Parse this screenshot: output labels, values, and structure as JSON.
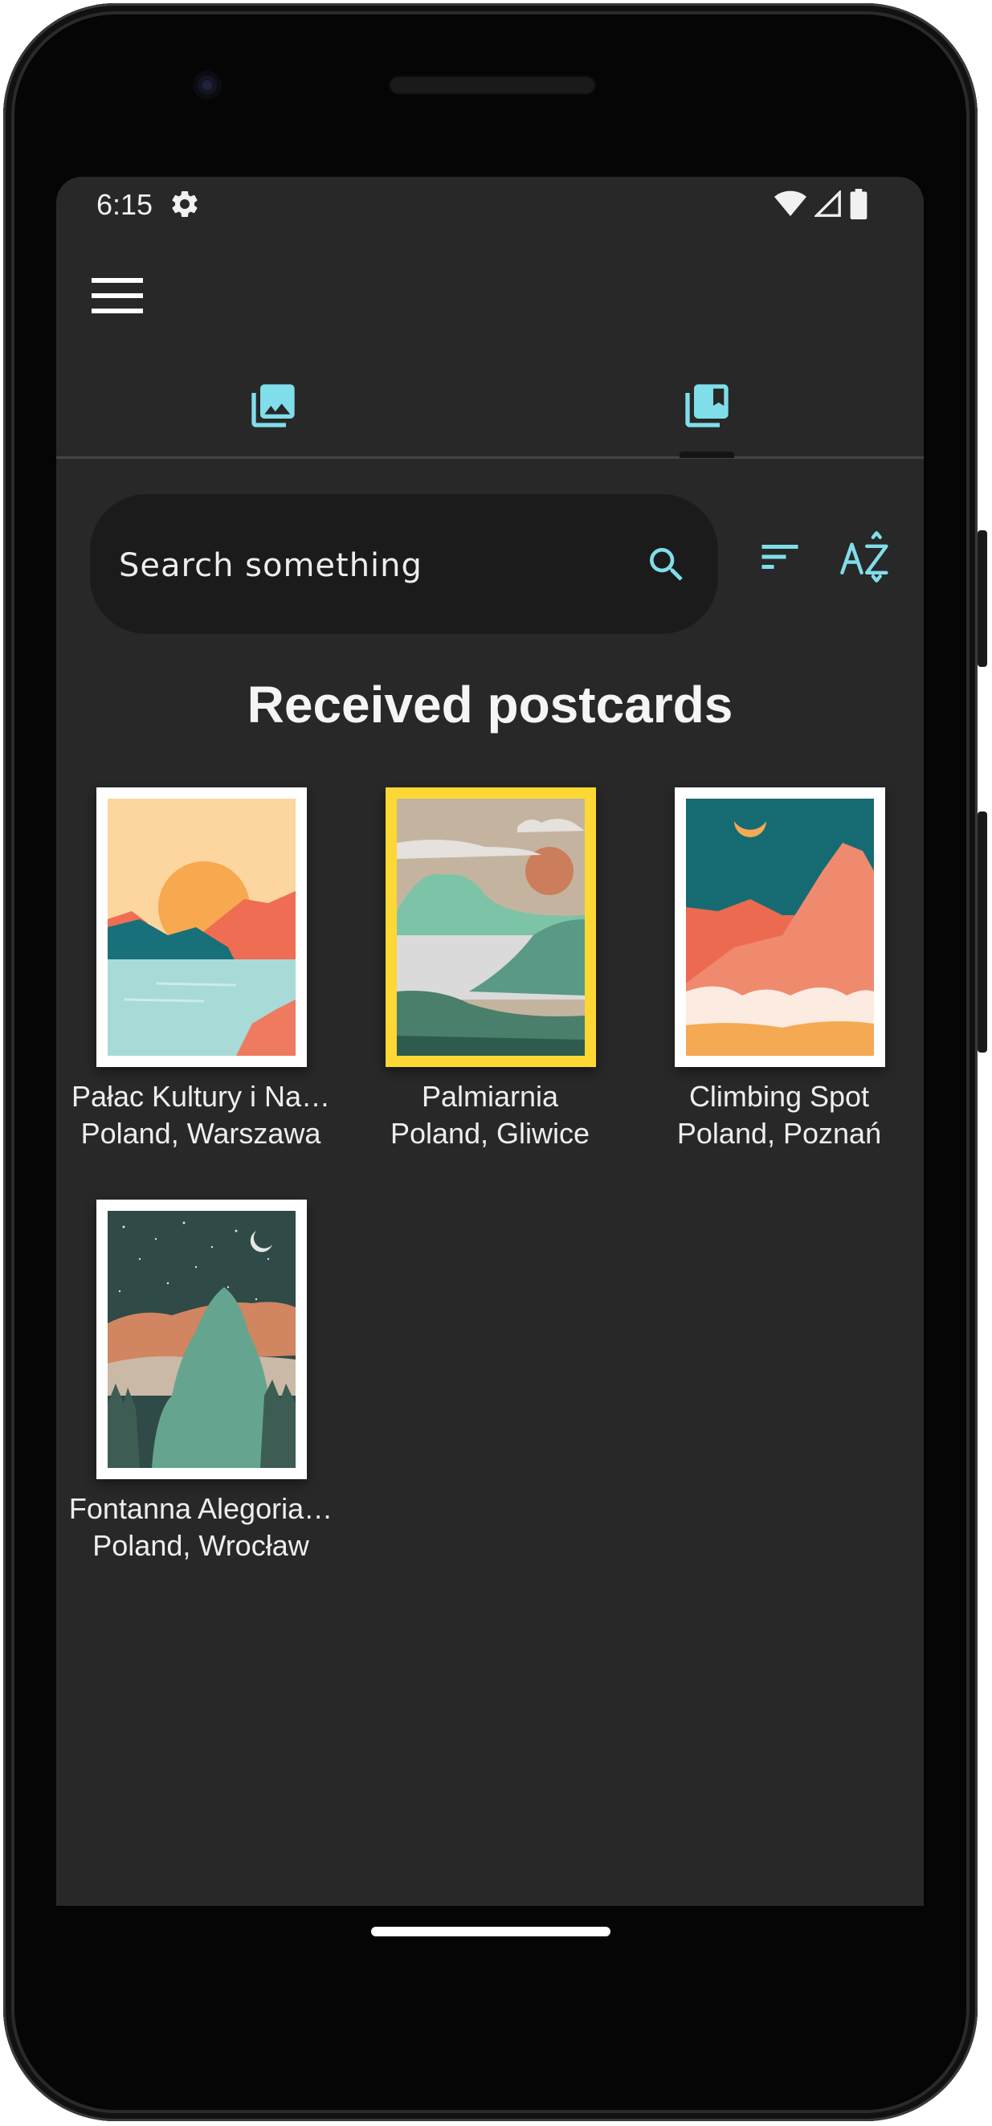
{
  "status_bar": {
    "time": "6:15"
  },
  "search": {
    "placeholder": "Search something"
  },
  "section": {
    "title": "Received postcards"
  },
  "postcards": [
    {
      "name": "Pałac Kultury i Na…",
      "location": "Poland, Warszawa",
      "selected": false
    },
    {
      "name": "Palmiarnia",
      "location": "Poland, Gliwice",
      "selected": true
    },
    {
      "name": "Climbing Spot",
      "location": "Poland, Poznań",
      "selected": false
    },
    {
      "name": "Fontanna Alegoria…",
      "location": "Poland, Wrocław",
      "selected": false
    }
  ],
  "icons": [
    "settings-icon",
    "wifi-icon",
    "signal-icon",
    "battery-icon",
    "menu-icon",
    "gallery-icon",
    "bookmark-collection-icon",
    "search-icon",
    "sort-icon",
    "sort-alpha-icon"
  ],
  "colors": {
    "accent": "#80deea",
    "selection": "#fdd835",
    "background": "#282828"
  }
}
